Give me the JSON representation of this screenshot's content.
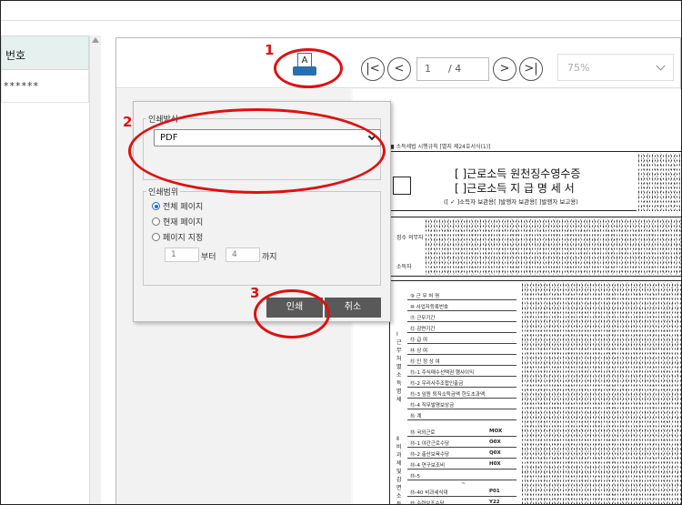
{
  "list_panel": {
    "header_label": "번호",
    "row_value": "******"
  },
  "viewer": {
    "print_icon_letter": "A",
    "page_current": "1",
    "page_total": "/ 4",
    "zoom_value": "75%",
    "nav": {
      "first": "|<",
      "prev": "<",
      "next": ">",
      "last": ">|"
    }
  },
  "document": {
    "caption": "■ 소득세법 시행규칙 [별지 제24호서식(1)]",
    "title_line1": "[ ]근로소득 원천징수영수증",
    "title_line2": "[ ]근로소득 지 급 명 세 서",
    "subtitle": "([ ✓ ]소득자 보관용[  ]발행자 보관용[  ]발행자 보고용)",
    "left_labels": [
      "징수 의무자",
      "소득자"
    ],
    "side_labels": [
      "Ⅰ 근무처별 소득 명세",
      "Ⅱ 비과세 및 감면 소득 명세"
    ],
    "rows": [
      "⑨ 근 무 처 명",
      "⑩ 사업자등록번호",
      "⑪ 근무기간",
      "⑫ 감면기간",
      "⑬ 급 여",
      "⑭ 상 여",
      "⑮ 인 정 상 여",
      "⑮-1 주식매수선택권 행사이익",
      "⑮-2 우리사주조합인출금",
      "⑮-3 임원 퇴직소득금액 한도초과액",
      "⑮-4 직무발명보상금",
      "⑯ 계"
    ],
    "rows2": [
      "⑱ 국외근로",
      "⑱-1 야간근로수당",
      "⑱-2 출산보육수당",
      "⑱-4 연구보조비",
      "⑱-5",
      "~",
      "⑱-40 비과세식대",
      "⑲ 수련보조수당"
    ],
    "codes2": [
      "MOX",
      "O0X",
      "Q0X",
      "H0X",
      "",
      "",
      "P01",
      "Y22"
    ]
  },
  "print_dialog": {
    "format_legend": "인쇄방식",
    "format_value": "PDF",
    "range_legend": "인쇄범위",
    "options": [
      "전체 페이지",
      "현재 페이지",
      "페이지 지정"
    ],
    "range_from": "1",
    "from_label": "부터",
    "range_to": "4",
    "to_label": "까지",
    "print_label": "인쇄",
    "cancel_label": "취소"
  },
  "annotations": {
    "step1": "1",
    "step2": "2",
    "step3": "3"
  },
  "colors": {
    "annotation_red": "#e01010",
    "print_icon_blue": "#2a6fb0",
    "radio_blue": "#1a6ed8",
    "button_gray": "#595959",
    "list_header_bg": "#e6f0ef"
  }
}
